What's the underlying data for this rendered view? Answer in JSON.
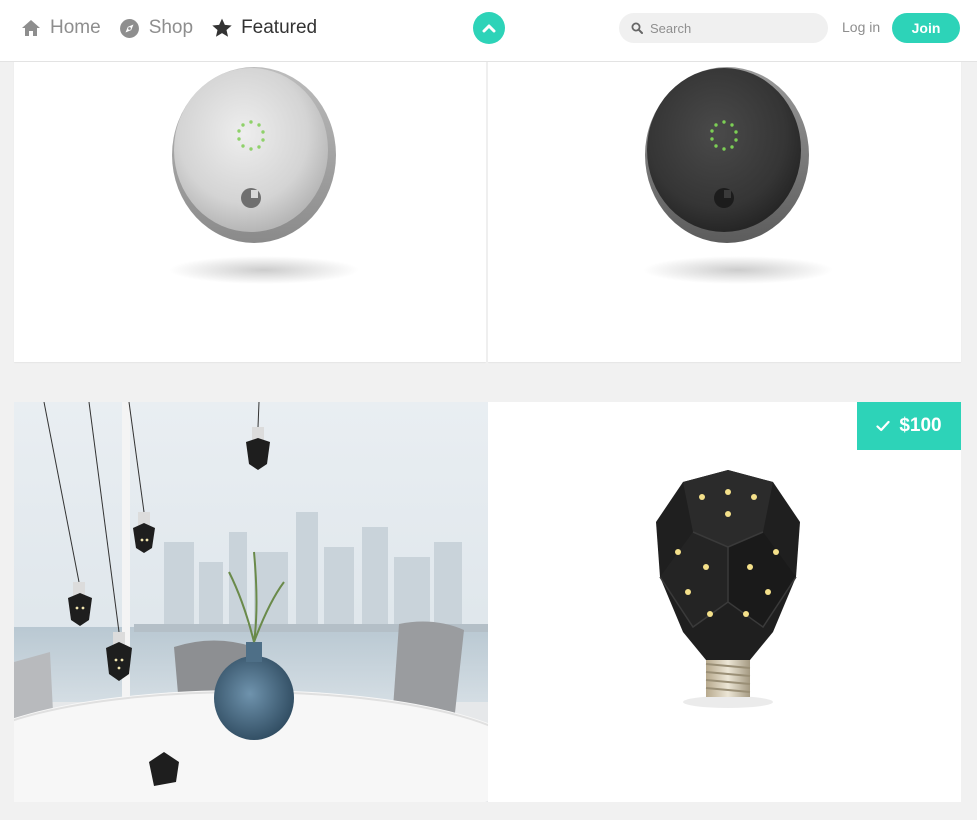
{
  "header": {
    "nav": [
      {
        "label": "Home",
        "icon": "home-icon"
      },
      {
        "label": "Shop",
        "icon": "compass-icon"
      },
      {
        "label": "Featured",
        "icon": "star-icon",
        "active": true
      }
    ],
    "scroll_top_icon": "chevron-up-icon",
    "search": {
      "placeholder": "Search",
      "value": ""
    },
    "login_label": "Log in",
    "join_label": "Join"
  },
  "products": [
    {
      "name": "smart-lock-silver",
      "image": "silver smart lock"
    },
    {
      "name": "smart-lock-dark",
      "image": "dark grey smart lock"
    },
    {
      "name": "pendant-bulbs-scene",
      "image": "pendant bulbs by a window"
    },
    {
      "name": "dodecahedron-bulb",
      "image": "black faceted LED bulb",
      "price": "$100",
      "selected": true
    }
  ],
  "colors": {
    "accent": "#2dd3b8",
    "nav_inactive": "#8e8e8e",
    "nav_active": "#333333",
    "page_background": "#f1f1f1"
  }
}
